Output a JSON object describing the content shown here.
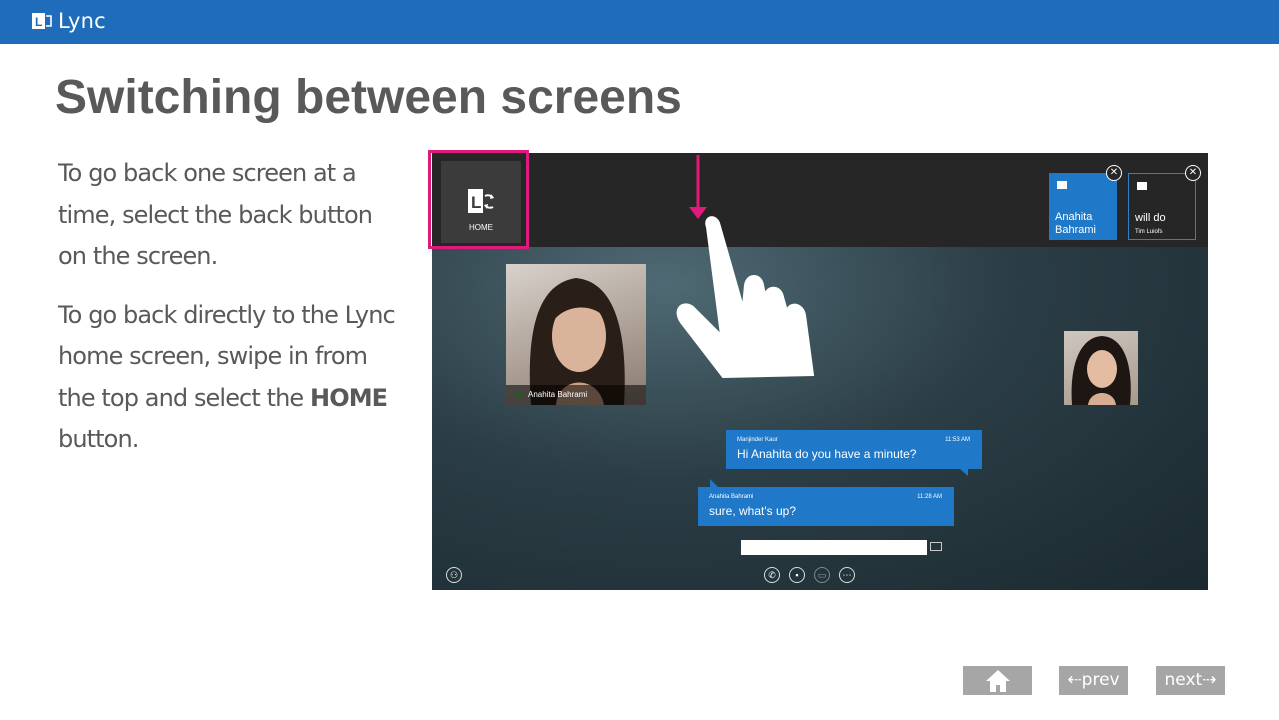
{
  "header": {
    "app_name": "Lync",
    "logo_icon": "lync-logo-icon",
    "bar_color": "#1f6dba"
  },
  "page": {
    "title": "Switching between screens",
    "para1": "To go back one screen at a time, select the back button on the screen.",
    "para2_before": "To go back directly to the Lync home screen, swipe in from the top  and select the ",
    "para2_bold": "HOME",
    "para2_after": " button."
  },
  "screenshot": {
    "home_label": "HOME",
    "highlight_color": "#e0197d",
    "tiles": [
      {
        "name": "Anahita Bahrami",
        "sub": ""
      },
      {
        "name": "will do",
        "sub": "Tim Luiofs"
      }
    ],
    "close_glyph": "✕",
    "video_caption": "Anahita Bahrami",
    "messages": [
      {
        "sender": "Manjinder Kaur",
        "time": "11:53 AM",
        "text": "Hi Anahita do you have a minute?"
      },
      {
        "sender": "Anahita Bahrami",
        "time": "11:28 AM",
        "text": "sure, what's up?"
      }
    ],
    "bottom_icons": [
      "participants-icon",
      "phone-icon",
      "video-icon",
      "chat-icon",
      "more-icon"
    ]
  },
  "nav": {
    "home_icon": "home-icon",
    "prev_label": "prev",
    "next_label": "next",
    "prev_arrow": "⇠",
    "next_arrow": "⇢"
  }
}
